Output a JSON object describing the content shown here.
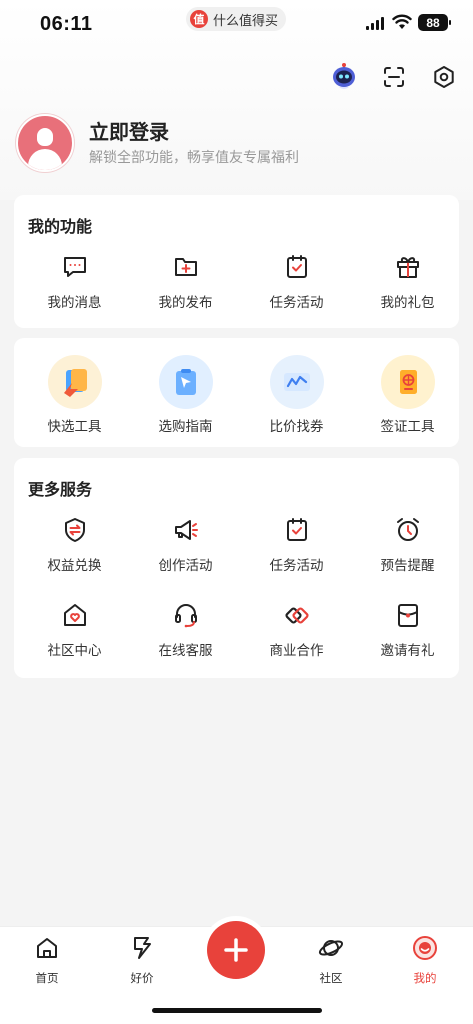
{
  "status_bar": {
    "time": "06:11",
    "app_name": "什么值得买",
    "app_logo_text": "值",
    "battery": "88"
  },
  "header": {
    "icons": [
      "robot-assistant-icon",
      "scan-icon",
      "settings-icon"
    ]
  },
  "profile": {
    "title": "立即登录",
    "subtitle": "解锁全部功能，畅享值友专属福利"
  },
  "my_functions": {
    "title": "我的功能",
    "items": [
      {
        "label": "我的消息",
        "icon": "message-icon"
      },
      {
        "label": "我的发布",
        "icon": "publish-folder-icon"
      },
      {
        "label": "任务活动",
        "icon": "task-clipboard-icon"
      },
      {
        "label": "我的礼包",
        "icon": "gift-icon"
      }
    ]
  },
  "tools": {
    "items": [
      {
        "label": "快选工具",
        "icon": "quick-pick-icon"
      },
      {
        "label": "选购指南",
        "icon": "buying-guide-icon"
      },
      {
        "label": "比价找券",
        "icon": "price-compare-icon"
      },
      {
        "label": "签证工具",
        "icon": "passport-icon"
      }
    ]
  },
  "more_services": {
    "title": "更多服务",
    "items": [
      {
        "label": "权益兑换",
        "icon": "exchange-shield-icon"
      },
      {
        "label": "创作活动",
        "icon": "megaphone-icon"
      },
      {
        "label": "任务活动",
        "icon": "task-clipboard-icon"
      },
      {
        "label": "预告提醒",
        "icon": "alarm-clock-icon"
      },
      {
        "label": "社区中心",
        "icon": "community-home-icon"
      },
      {
        "label": "在线客服",
        "icon": "headset-icon"
      },
      {
        "label": "商业合作",
        "icon": "handshake-icon"
      },
      {
        "label": "邀请有礼",
        "icon": "invite-envelope-icon"
      }
    ]
  },
  "tabbar": {
    "tabs": [
      {
        "label": "首页",
        "icon": "home-icon"
      },
      {
        "label": "好价",
        "icon": "deal-icon"
      },
      {
        "label": "社区",
        "icon": "planet-icon"
      },
      {
        "label": "我的",
        "icon": "profile-face-icon"
      }
    ],
    "active_tab": "我的",
    "fab": "post-add-icon"
  },
  "colors": {
    "accent": "#e8423b",
    "background": "#f4f4f4",
    "card": "#ffffff"
  }
}
